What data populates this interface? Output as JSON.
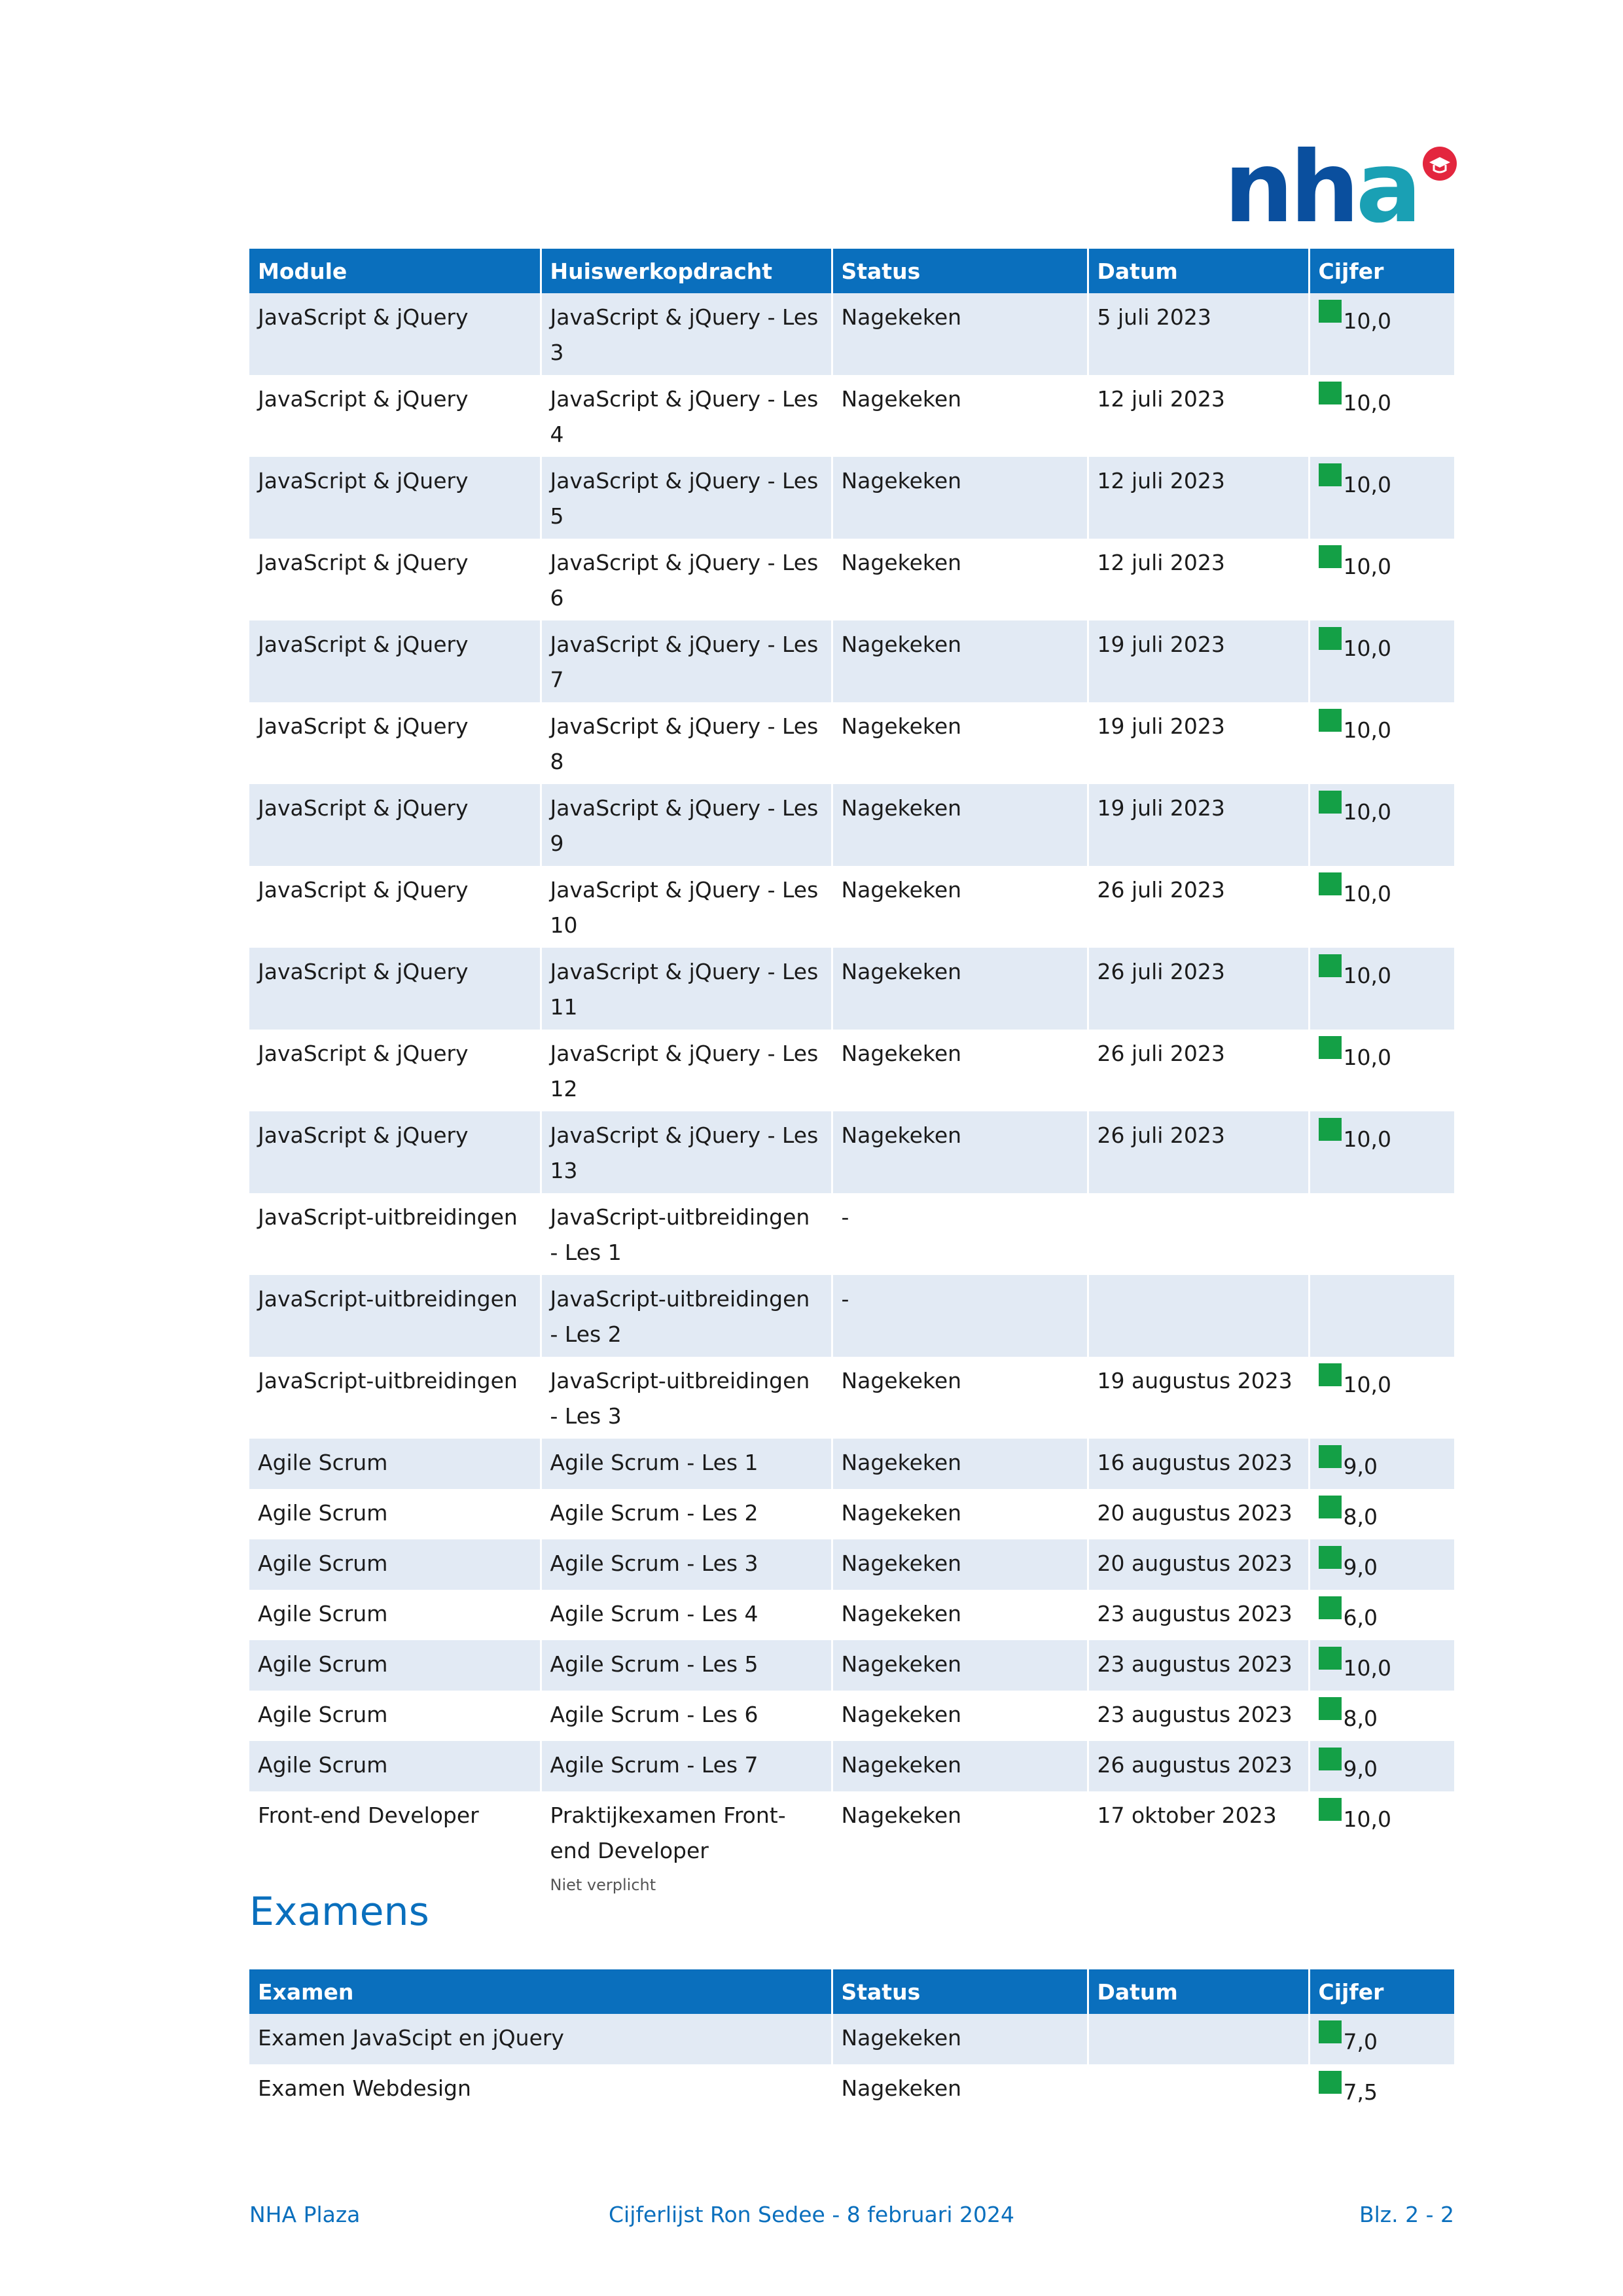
{
  "logo": {
    "text": "nha",
    "colors": {
      "blue": "#0a4f9e",
      "teal": "#1aa0b4",
      "red": "#e3263e"
    }
  },
  "grades_table": {
    "headers": [
      "Module",
      "Huiswerkopdracht",
      "Status",
      "Datum",
      "Cijfer"
    ],
    "rows": [
      {
        "module": "JavaScript & jQuery",
        "assignment": "JavaScript & jQuery - Les 3",
        "status": "Nagekeken",
        "date": "5 juli 2023",
        "grade": "10,0"
      },
      {
        "module": "JavaScript & jQuery",
        "assignment": "JavaScript & jQuery - Les 4",
        "status": "Nagekeken",
        "date": "12 juli 2023",
        "grade": "10,0"
      },
      {
        "module": "JavaScript & jQuery",
        "assignment": "JavaScript & jQuery - Les 5",
        "status": "Nagekeken",
        "date": "12 juli 2023",
        "grade": "10,0"
      },
      {
        "module": "JavaScript & jQuery",
        "assignment": "JavaScript & jQuery - Les 6",
        "status": "Nagekeken",
        "date": "12 juli 2023",
        "grade": "10,0"
      },
      {
        "module": "JavaScript & jQuery",
        "assignment": "JavaScript & jQuery - Les 7",
        "status": "Nagekeken",
        "date": "19 juli 2023",
        "grade": "10,0"
      },
      {
        "module": "JavaScript & jQuery",
        "assignment": "JavaScript & jQuery - Les 8",
        "status": "Nagekeken",
        "date": "19 juli 2023",
        "grade": "10,0"
      },
      {
        "module": "JavaScript & jQuery",
        "assignment": "JavaScript & jQuery - Les 9",
        "status": "Nagekeken",
        "date": "19 juli 2023",
        "grade": "10,0"
      },
      {
        "module": "JavaScript & jQuery",
        "assignment": "JavaScript & jQuery - Les 10",
        "status": "Nagekeken",
        "date": "26 juli 2023",
        "grade": "10,0"
      },
      {
        "module": "JavaScript & jQuery",
        "assignment": "JavaScript & jQuery - Les 11",
        "status": "Nagekeken",
        "date": "26 juli 2023",
        "grade": "10,0"
      },
      {
        "module": "JavaScript & jQuery",
        "assignment": "JavaScript & jQuery - Les 12",
        "status": "Nagekeken",
        "date": "26 juli 2023",
        "grade": "10,0"
      },
      {
        "module": "JavaScript & jQuery",
        "assignment": "JavaScript & jQuery - Les 13",
        "status": "Nagekeken",
        "date": "26 juli 2023",
        "grade": "10,0"
      },
      {
        "module": "JavaScript-uitbreidingen",
        "assignment": "JavaScript-uitbreidingen - Les 1",
        "status": "-",
        "date": "",
        "grade": ""
      },
      {
        "module": "JavaScript-uitbreidingen",
        "assignment": "JavaScript-uitbreidingen - Les 2",
        "status": "-",
        "date": "",
        "grade": ""
      },
      {
        "module": "JavaScript-uitbreidingen",
        "assignment": "JavaScript-uitbreidingen - Les 3",
        "status": "Nagekeken",
        "date": "19 augustus 2023",
        "grade": "10,0"
      },
      {
        "module": "Agile Scrum",
        "assignment": "Agile Scrum - Les 1",
        "status": "Nagekeken",
        "date": "16 augustus 2023",
        "grade": "9,0"
      },
      {
        "module": "Agile Scrum",
        "assignment": "Agile Scrum - Les 2",
        "status": "Nagekeken",
        "date": "20 augustus 2023",
        "grade": "8,0"
      },
      {
        "module": "Agile Scrum",
        "assignment": "Agile Scrum - Les 3",
        "status": "Nagekeken",
        "date": "20 augustus 2023",
        "grade": "9,0"
      },
      {
        "module": "Agile Scrum",
        "assignment": "Agile Scrum - Les 4",
        "status": "Nagekeken",
        "date": "23 augustus 2023",
        "grade": "6,0"
      },
      {
        "module": "Agile Scrum",
        "assignment": "Agile Scrum - Les 5",
        "status": "Nagekeken",
        "date": "23 augustus 2023",
        "grade": "10,0"
      },
      {
        "module": "Agile Scrum",
        "assignment": "Agile Scrum - Les 6",
        "status": "Nagekeken",
        "date": "23 augustus 2023",
        "grade": "8,0"
      },
      {
        "module": "Agile Scrum",
        "assignment": "Agile Scrum - Les 7",
        "status": "Nagekeken",
        "date": "26 augustus 2023",
        "grade": "9,0"
      },
      {
        "module": "Front-end Developer",
        "assignment": "Praktijkexamen Front-end Developer",
        "note": "Niet verplicht",
        "status": "Nagekeken",
        "date": "17 oktober 2023",
        "grade": "10,0"
      }
    ]
  },
  "exams_section": {
    "title": "Examens",
    "headers": [
      "Examen",
      "Status",
      "Datum",
      "Cijfer"
    ],
    "rows": [
      {
        "exam": "Examen JavaScipt en jQuery",
        "status": "Nagekeken",
        "date": "",
        "grade": "7,0"
      },
      {
        "exam": "Examen Webdesign",
        "status": "Nagekeken",
        "date": "",
        "grade": "7,5"
      }
    ]
  },
  "grade_indicator_color": "#14a046",
  "footer": {
    "left": "NHA Plaza",
    "center": "Cijferlijst Ron Sedee - 8 februari 2024",
    "right": "Blz. 2 - 2"
  }
}
